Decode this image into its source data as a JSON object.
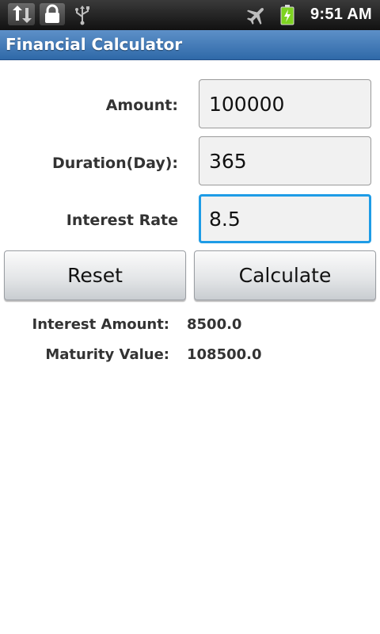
{
  "status_bar": {
    "time": "9:51 AM",
    "icons": [
      "sync-icon",
      "lock-icon",
      "usb-icon",
      "airplane-mode-icon",
      "battery-charging-icon"
    ],
    "battery_color": "#7ed321"
  },
  "app": {
    "title": "Financial Calculator",
    "accent_color": "#2f69a8"
  },
  "form": {
    "amount_label": "Amount:",
    "amount_value": "100000",
    "duration_label": "Duration(Day):",
    "duration_value": "365",
    "rate_label": "Interest Rate",
    "rate_value": "8.5",
    "focused_field": "interest-rate"
  },
  "buttons": {
    "reset_label": "Reset",
    "calculate_label": "Calculate"
  },
  "results": {
    "interest_label": "Interest Amount:",
    "interest_value": "8500.0",
    "maturity_label": "Maturity Value:",
    "maturity_value": "108500.0"
  }
}
